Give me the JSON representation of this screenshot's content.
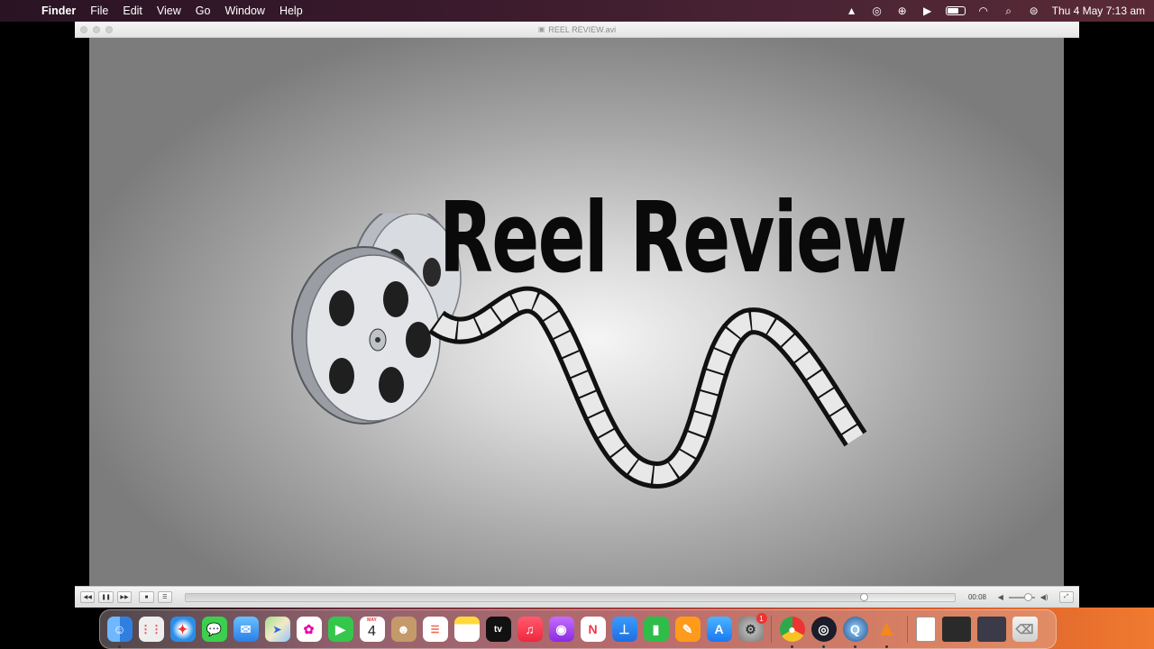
{
  "menubar": {
    "items": [
      "Finder",
      "File",
      "Edit",
      "View",
      "Go",
      "Window",
      "Help"
    ],
    "clock": "Thu 4 May  7:13 am"
  },
  "window": {
    "title": "REEL REVIEW.avi"
  },
  "video": {
    "headline": "Reel Review"
  },
  "controls": {
    "rewind": "◀◀",
    "pause": "❚❚",
    "forward": "▶▶",
    "stop": "■",
    "playlist": "☰",
    "elapsed": "00:08",
    "progress_fraction": 0.883,
    "volume_fraction": 0.75
  },
  "dock": {
    "calendar_month": "MAY",
    "calendar_day": "4",
    "settings_badge": "1",
    "apple_tv_label": "tv"
  },
  "colors": {
    "finder": "#3a8ee6",
    "messages": "#3ccf4e",
    "vlc": "#f28a1a"
  }
}
